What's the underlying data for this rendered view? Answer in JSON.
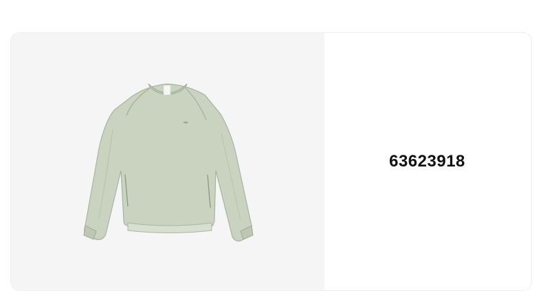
{
  "product": {
    "id": "63623918",
    "image_icon": "sweatshirt-image",
    "garment_color": "#c9d3c0",
    "panel_color": "#f5f5f5"
  }
}
